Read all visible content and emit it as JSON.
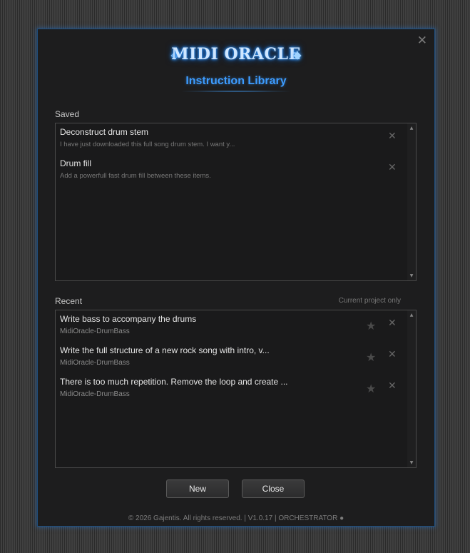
{
  "app": {
    "logo": "MIDI ORACLE",
    "close_glyph": "✕"
  },
  "dialog": {
    "title": "Instruction Library"
  },
  "saved": {
    "label": "Saved",
    "items": [
      {
        "title": "Deconstruct drum stem",
        "subtitle": "I have just downloaded this full song drum stem. I want y..."
      },
      {
        "title": "Drum fill",
        "subtitle": "Add a powerfull fast drum fill between these items."
      }
    ]
  },
  "recent": {
    "label": "Recent",
    "filter_hint": "Current project only",
    "items": [
      {
        "title": "Write bass to accompany the drums",
        "project": "MidiOracle-DrumBass"
      },
      {
        "title": "Write the full structure of a new rock song with intro, v...",
        "project": "MidiOracle-DrumBass"
      },
      {
        "title": "There is too much repetition. Remove the loop and create ...",
        "project": "MidiOracle-DrumBass"
      }
    ]
  },
  "icons": {
    "delete": "✕",
    "star": "★",
    "scroll_up": "▲",
    "scroll_down": "▼"
  },
  "buttons": {
    "new_label": "New",
    "close_label": "Close"
  },
  "footer": {
    "text": "© 2026 Gajentis. All rights reserved.  |  V1.0.17  |  ORCHESTRATOR ●"
  },
  "colors": {
    "accent": "#3d9cff",
    "background": "#1d1d1e",
    "border_glow": "#1f4e7d"
  }
}
